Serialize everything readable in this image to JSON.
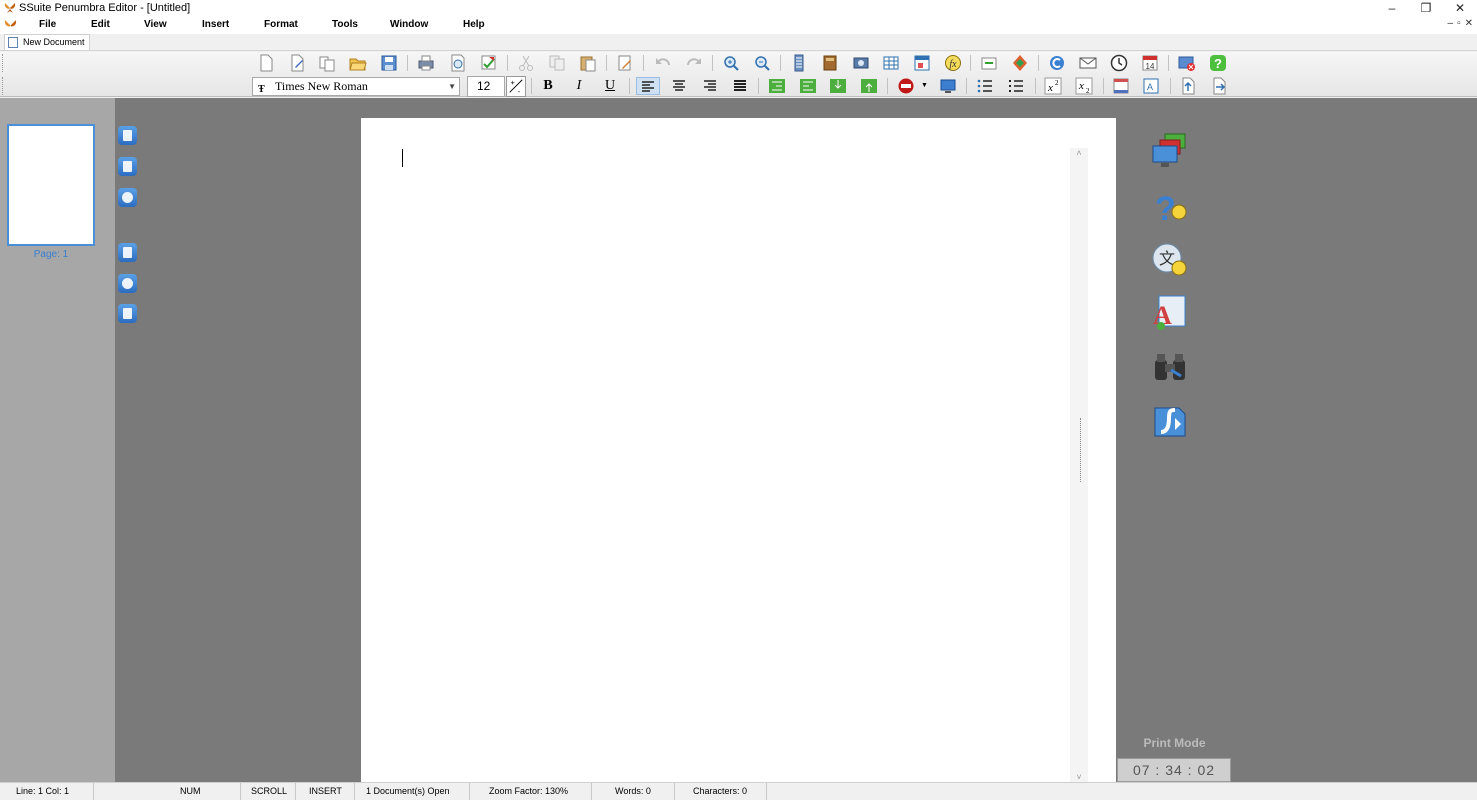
{
  "window": {
    "title": "SSuite Penumbra Editor - [Untitled]",
    "controls": {
      "minimize": "–",
      "restore": "❐",
      "close": "✕"
    }
  },
  "menu": {
    "items": [
      "File",
      "Edit",
      "View",
      "Insert",
      "Format",
      "Tools",
      "Window",
      "Help"
    ],
    "mdi_controls": {
      "minimize": "–",
      "restore": "▫",
      "close": "✕"
    }
  },
  "tabs": [
    {
      "label": "New Document"
    }
  ],
  "format_toolbar": {
    "font_family": "Times New Roman",
    "font_size": "12",
    "bold": "B",
    "italic": "I",
    "underline": "U"
  },
  "thumbnails": {
    "page_label": "Page: 1"
  },
  "right_panel": {
    "mode_label": "Print Mode",
    "clock": "07 : 34 : 02"
  },
  "status": {
    "line_col": "Line:   1  Col:   1",
    "num": "NUM",
    "scroll": "SCROLL",
    "insert": "INSERT",
    "documents_open": "1 Document(s) Open",
    "zoom": "Zoom Factor: 130%",
    "words": "Words: 0",
    "characters": "Characters: 0"
  },
  "colors": {
    "accent": "#4a90d9",
    "workspace": "#7a7a7a",
    "thumb_pane": "#a7a7a7"
  }
}
